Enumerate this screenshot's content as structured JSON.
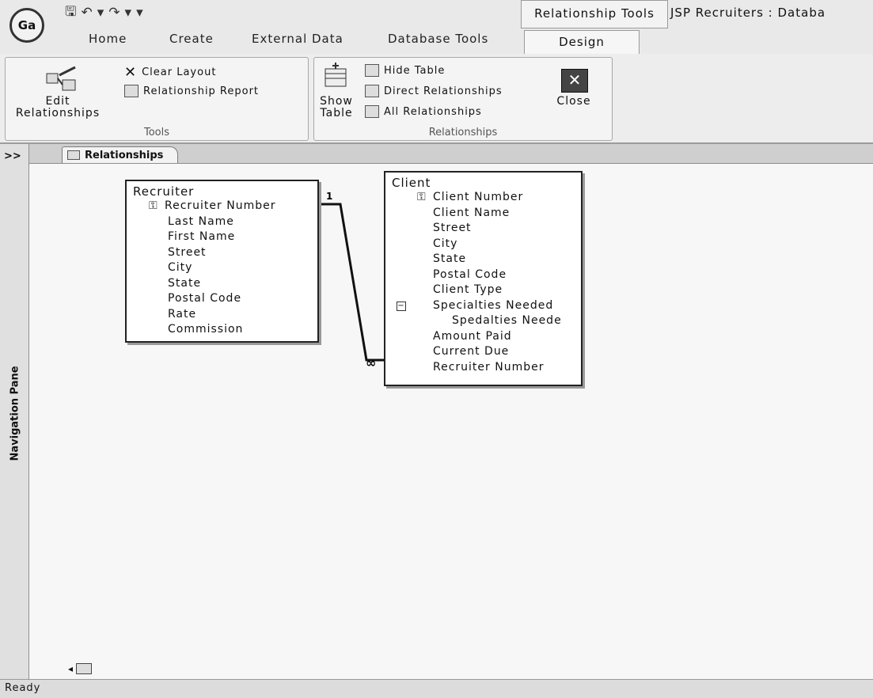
{
  "app": {
    "office_button": "Ga",
    "context_tab_header": "Relationship Tools",
    "document_title": "JSP Recruiters : Databa"
  },
  "ribbon_tabs": [
    "Home",
    "Create",
    "External Data",
    "Database Tools"
  ],
  "active_tab": "Design",
  "tools_group": {
    "label": "Tools",
    "edit_relationships": "Edit\nRelationships",
    "clear_layout": "Clear Layout",
    "relationship_report": "Relationship Report"
  },
  "relationships_group": {
    "label": "Relationships",
    "show_table": "Show\nTable",
    "hide_table": "Hide Table",
    "direct_relationships": "Direct Relationships",
    "all_relationships": "All Relationships",
    "close": "Close"
  },
  "nav_pane": {
    "toggle": ">>",
    "label": "Navigation Pane"
  },
  "document_tab": {
    "label": "Relationships"
  },
  "tables": {
    "recruiter": {
      "title": "Recruiter",
      "fields": [
        "Recruiter Number",
        "Last Name",
        "First Name",
        "Street",
        "City",
        "State",
        "Postal Code",
        "Rate",
        "Commission"
      ]
    },
    "client": {
      "title": "Client",
      "fields": [
        "Client Number",
        "Client Name",
        "Street",
        "City",
        "State",
        "Postal Code",
        "Client Type",
        "Specialties Needed",
        "Spedalties Neede",
        "Amount Paid",
        "Current Due",
        "Recruiter Number"
      ]
    }
  },
  "relationship": {
    "one_side": "1",
    "many_side": "∞"
  },
  "status": {
    "text": "Ready"
  }
}
